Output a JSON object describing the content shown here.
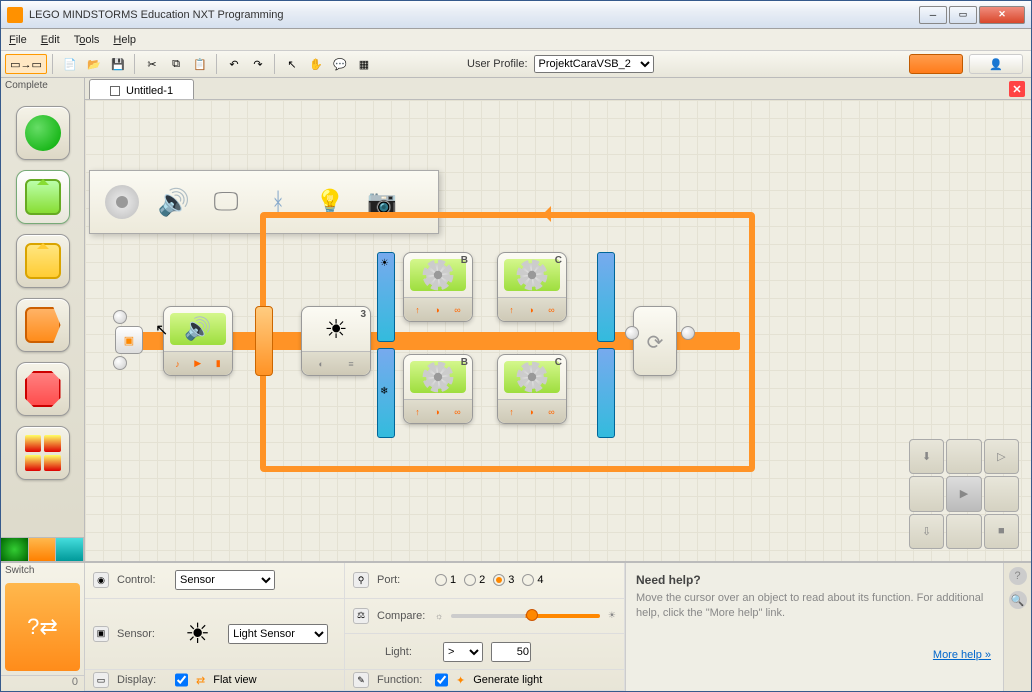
{
  "window": {
    "title": "LEGO MINDSTORMS Education NXT Programming"
  },
  "menu": {
    "file": "File",
    "edit": "Edit",
    "tools": "Tools",
    "help": "Help"
  },
  "toolbar": {
    "profile_label": "User Profile:",
    "profile_value": "ProjektCaraVSB_2"
  },
  "sidebar": {
    "header": "Complete"
  },
  "tab": {
    "name": "Untitled-1"
  },
  "blocks": {
    "motor_b": "B",
    "motor_c": "C",
    "switch_val": "3"
  },
  "config": {
    "panel_title": "Switch",
    "control_label": "Control:",
    "control_value": "Sensor",
    "sensor_label": "Sensor:",
    "sensor_value": "Light Sensor",
    "display_label": "Display:",
    "display_value": "Flat view",
    "port_label": "Port:",
    "ports": [
      "1",
      "2",
      "3",
      "4"
    ],
    "port_selected": "3",
    "compare_label": "Compare:",
    "light_label": "Light:",
    "light_op": ">",
    "light_val": "50",
    "function_label": "Function:",
    "function_value": "Generate light",
    "count": "0"
  },
  "help": {
    "title": "Need help?",
    "body": "Move the cursor over an object to read about its function. For additional help, click the \"More help\" link.",
    "link": "More help »"
  }
}
